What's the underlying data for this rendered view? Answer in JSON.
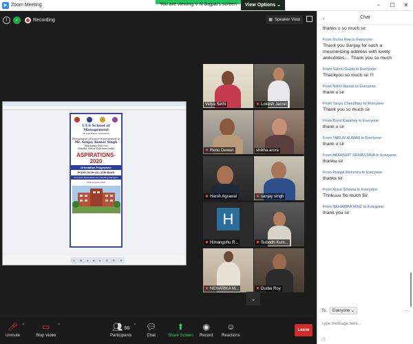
{
  "window": {
    "title": "Zoom Meeting",
    "controls": [
      "–",
      "☐",
      "✕"
    ]
  },
  "banner": {
    "message": "You are viewing V N Bajpai's screen",
    "options_label": "View Options ⌄"
  },
  "topbar": {
    "recording_label": "Recording",
    "speaker_view_label": "Speaker View"
  },
  "plaque": {
    "school": "I.T.S School of Management",
    "location": "Mohan Nagar, Ghaziabad",
    "presented_line": "This plaque of honor is presented to",
    "honoree": "Mr. Sanjay Kumar Singh",
    "title1": "Managing Director",
    "title2": "Yamaha Motor Solutions India",
    "event": "ASPIRATIONS-2020",
    "program": "Orientation Programme",
    "batch": "PGDM (2020-22), 25th Batch",
    "corp_line": "Corporate Expectations from Budding Managers",
    "date": "18th August 2020"
  },
  "participants": [
    {
      "name": "Vidya Sethi"
    },
    {
      "name": "Lokesh Jacrel"
    },
    {
      "name": "Renu Dewan"
    },
    {
      "name": "shikha arora"
    },
    {
      "name": "Harsh Agrawal"
    },
    {
      "name": "sanjay singh"
    },
    {
      "name": "Himangshu R...",
      "initial": "H"
    },
    {
      "name": "Subodh Kum..."
    },
    {
      "name": "NEHARIKA M..."
    },
    {
      "name": "Durba Roy"
    }
  ],
  "toolbar": {
    "unmute": "Unmute",
    "stop_video": "Stop Video",
    "participants": "Participants",
    "participants_count": "56",
    "chat": "Chat",
    "share_screen": "Share Screen",
    "record": "Record",
    "reactions": "Reactions",
    "leave": "Leave"
  },
  "chat": {
    "title": "Chat",
    "messages": [
      {
        "from": "",
        "recipient": "",
        "text": "thanks u so much sir"
      },
      {
        "from": "Durba Roy",
        "recipient": "Everyone",
        "text": "Thank you Sanjay for such a mesmerizing address with lovely anecdotes.... Thank you so much"
      },
      {
        "from": "Saloni Gupta",
        "recipient": "Everyone",
        "text": "Thankyou so much sir !!!"
      },
      {
        "from": "Nikhil Kumar",
        "recipient": "Everyone",
        "text": "thank u sir"
      },
      {
        "from": "Tanya Chaudhary",
        "recipient": "Everyone",
        "text": "Thank you so much sir"
      },
      {
        "from": "Rohit Kapshey",
        "recipient": "Everyone",
        "text": "thank u sir"
      },
      {
        "from": "TARUN KUMAR",
        "recipient": "Everyone",
        "text": "thank u sir"
      },
      {
        "from": "AKARSHIT SRIVASTAVA",
        "recipient": "Everyone",
        "text": "thanku sir"
      },
      {
        "from": "Pranjal Mehrotra",
        "recipient": "Everyone",
        "text": "thanks sir"
      },
      {
        "from": "Khusi Shweta",
        "recipient": "Everyone",
        "text": "Thnkuuu So much Sir"
      },
      {
        "from": "NEHARIKA MINZ",
        "recipient": "Everyone",
        "text": "thank you sir"
      }
    ],
    "from_prefix": "From",
    "to_word": "to",
    "to_label": "To:",
    "to_value": "Everyone ⌄",
    "input_placeholder": "Type message here..."
  },
  "colors": {
    "accent": "#2d8cff",
    "active_speaker": "#d9e23c",
    "leave": "#d12b2b",
    "share": "#2ecc71"
  }
}
